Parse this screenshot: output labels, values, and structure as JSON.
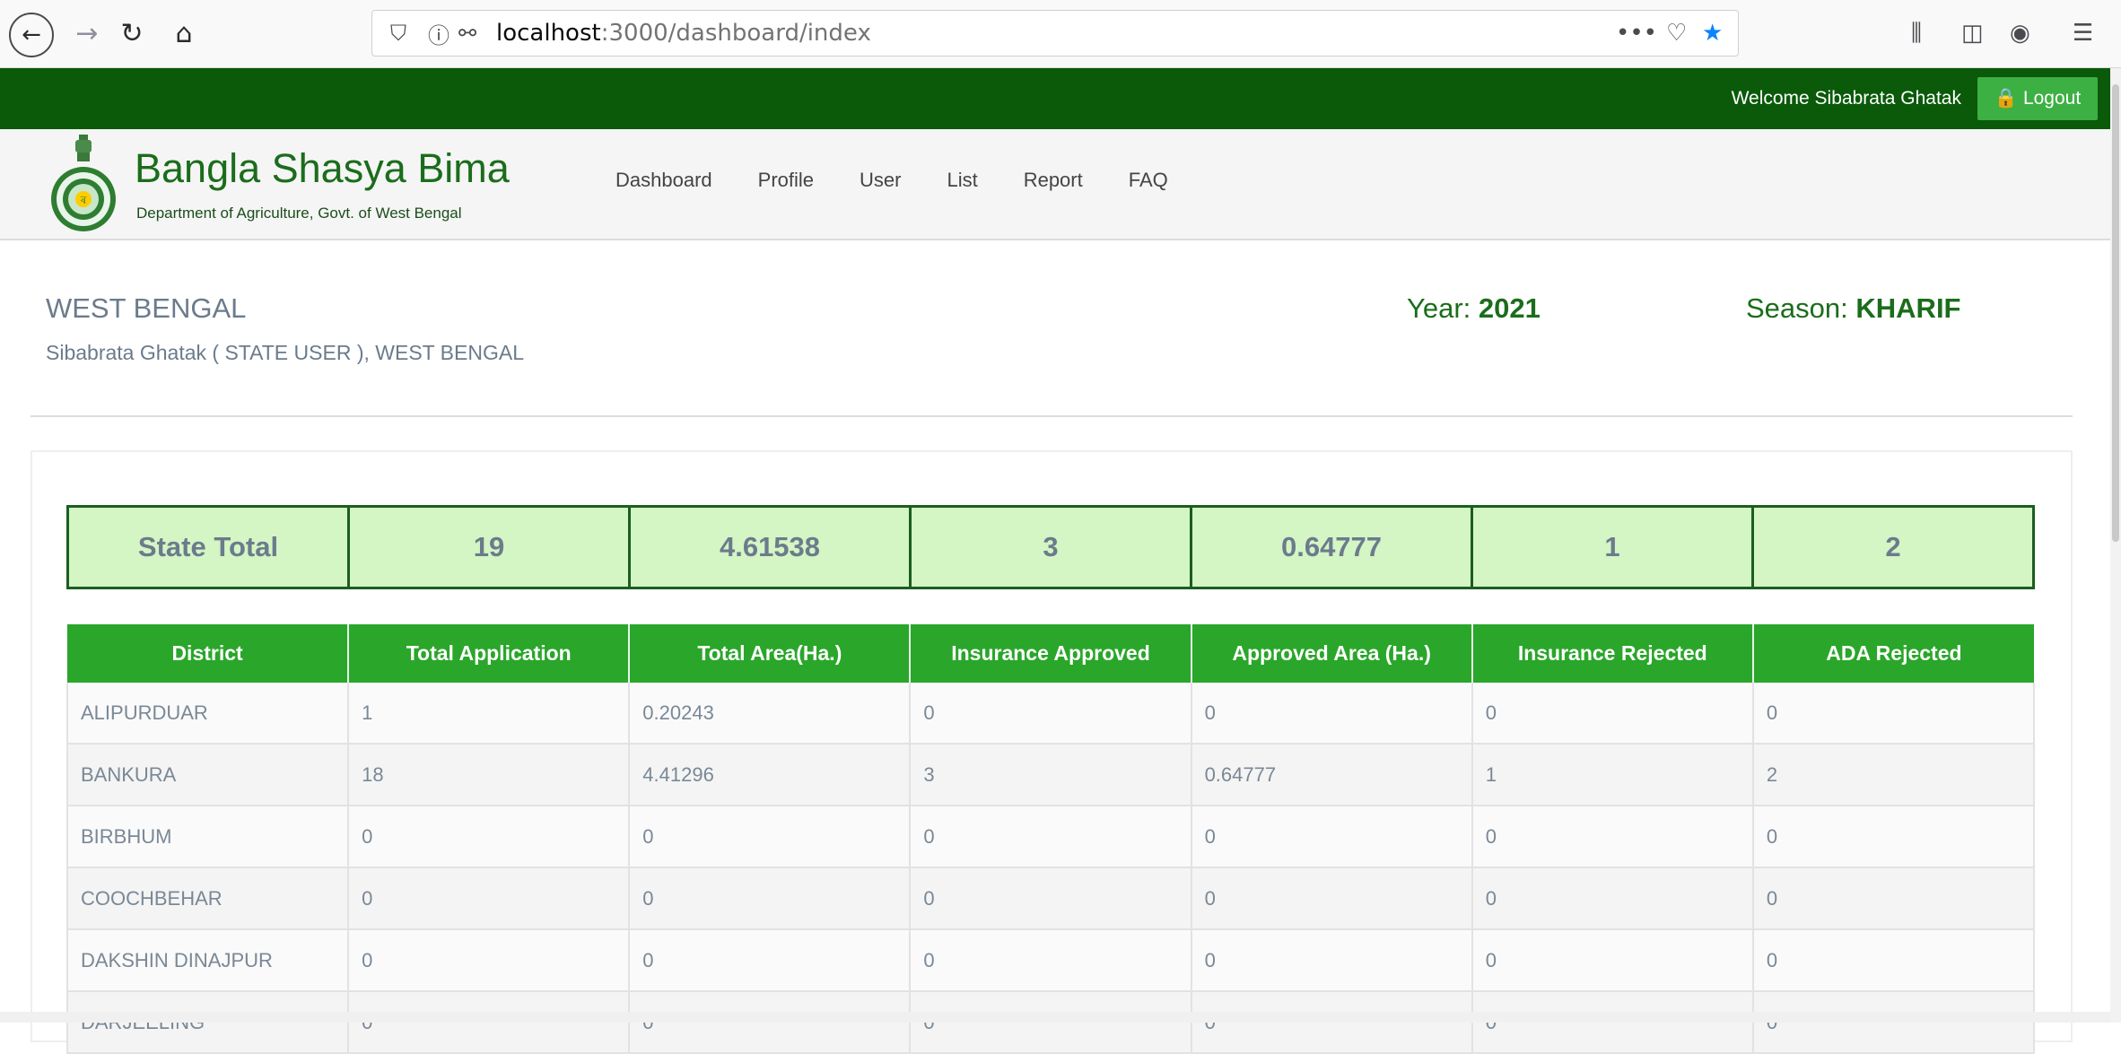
{
  "browser": {
    "url_host": "localhost",
    "url_path": ":3000/dashboard/index"
  },
  "topbar": {
    "welcome": "Welcome Sibabrata Ghatak",
    "logout_label": "Logout"
  },
  "brand": {
    "title": "Bangla Shasya Bima",
    "subtitle": "Department of Agriculture, Govt. of West Bengal"
  },
  "nav": [
    "Dashboard",
    "Profile",
    "User",
    "List",
    "Report",
    "FAQ"
  ],
  "info": {
    "state": "WEST BENGAL",
    "user_line": "Sibabrata Ghatak ( STATE USER ), WEST BENGAL",
    "year_label": "Year:",
    "year_value": "2021",
    "season_label": "Season:",
    "season_value": "KHARIF"
  },
  "state_total": [
    "State Total",
    "19",
    "4.61538",
    "3",
    "0.64777",
    "1",
    "2"
  ],
  "table": {
    "headers": [
      "District",
      "Total Application",
      "Total Area(Ha.)",
      "Insurance Approved",
      "Approved Area (Ha.)",
      "Insurance Rejected",
      "ADA Rejected"
    ],
    "rows": [
      [
        "ALIPURDUAR",
        "1",
        "0.20243",
        "0",
        "0",
        "0",
        "0"
      ],
      [
        "BANKURA",
        "18",
        "4.41296",
        "3",
        "0.64777",
        "1",
        "2"
      ],
      [
        "BIRBHUM",
        "0",
        "0",
        "0",
        "0",
        "0",
        "0"
      ],
      [
        "COOCHBEHAR",
        "0",
        "0",
        "0",
        "0",
        "0",
        "0"
      ],
      [
        "DAKSHIN DINAJPUR",
        "0",
        "0",
        "0",
        "0",
        "0",
        "0"
      ],
      [
        "DARJEELING",
        "0",
        "0",
        "0",
        "0",
        "0",
        "0"
      ]
    ]
  },
  "colors": {
    "top_strip": "#0a5a0a",
    "logout_bg": "#3cb043",
    "header_row": "#2aa62a",
    "total_bg": "#d4f5c4",
    "brand_green": "#1b6d1b"
  }
}
